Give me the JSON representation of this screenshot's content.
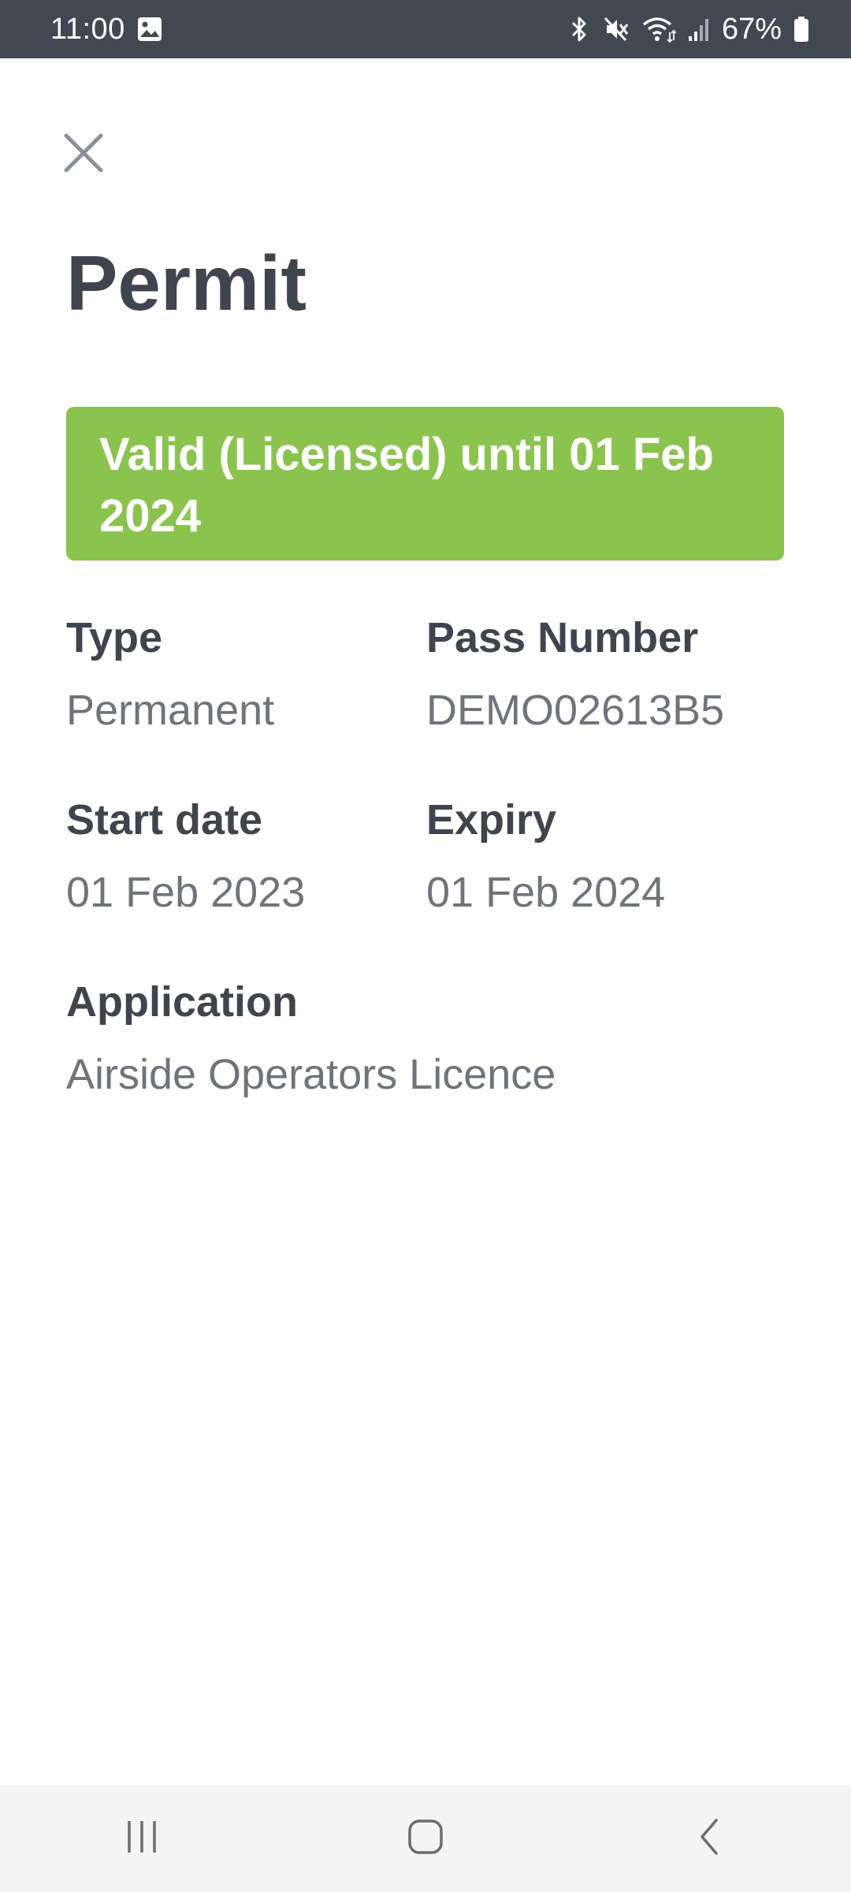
{
  "status_bar": {
    "time": "11:00",
    "battery_percent": "67%",
    "icons": [
      "gallery-icon",
      "bluetooth-icon",
      "mute-icon",
      "wifi-icon",
      "signal-icon",
      "battery-icon"
    ]
  },
  "header": {
    "close_icon": "close-icon",
    "title": "Permit"
  },
  "status_banner": {
    "text": "Valid (Licensed) until 01 Feb 2024",
    "color": "#8bc34f"
  },
  "details": {
    "type": {
      "label": "Type",
      "value": "Permanent"
    },
    "pass_number": {
      "label": "Pass Number",
      "value": "DEMO02613B5"
    },
    "start_date": {
      "label": "Start date",
      "value": "01 Feb 2023"
    },
    "expiry": {
      "label": "Expiry",
      "value": "01 Feb 2024"
    },
    "application": {
      "label": "Application",
      "value": "Airside Operators Licence"
    }
  },
  "nav_bar": {
    "icons": [
      "recent-apps-icon",
      "home-icon",
      "back-icon"
    ]
  },
  "colors": {
    "status_bar_bg": "#424852",
    "title_text": "#3f444e",
    "value_text": "#6f737b",
    "nav_bg": "#f4f4f4"
  }
}
